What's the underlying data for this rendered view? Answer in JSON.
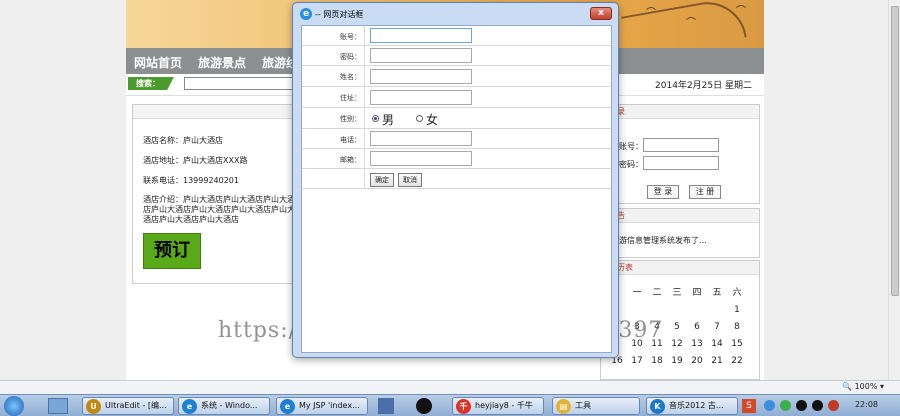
{
  "site": {
    "nav": [
      "网站首页",
      "旅游景点",
      "旅游线"
    ],
    "search_label": "搜索：",
    "date": "2014年2月25日 星期二"
  },
  "hotel": {
    "name_line": "酒店名称：庐山大酒店",
    "address_line": "酒店地址：庐山大酒店XXX路",
    "phone_line": "联系电话：13999240201",
    "intro_line": "酒店介绍：庐山大酒店庐山大酒店庐山大酒店庐山大酒店庐山大酒店庐山大酒店庐山大酒店庐山大酒店庐山大酒店",
    "book_label": "预订"
  },
  "sidebar": {
    "login_head": "录",
    "account_label": "账号：",
    "password_label": "密码：",
    "login_button": "登 录",
    "register_button": "注 册",
    "news_head": "告",
    "news_item": "游信息管理系统发布了…",
    "calendar_head": "历表",
    "calendar_weekdays": [
      "一",
      "二",
      "三",
      "四",
      "五",
      "六"
    ],
    "calendar_rows": [
      [
        "",
        "",
        "",
        "",
        "",
        "1"
      ],
      [
        "3",
        "4",
        "5",
        "6",
        "7",
        "8"
      ],
      [
        "10",
        "11",
        "12",
        "13",
        "14",
        "15"
      ],
      [
        "17",
        "18",
        "19",
        "20",
        "21",
        "22"
      ]
    ],
    "calendar_left_col": [
      "",
      "",
      "",
      "16"
    ]
  },
  "watermark": "https://www.huzhan.com/ishop39397",
  "dialog": {
    "title": "-- 网页对话框",
    "close": "x",
    "fields": [
      {
        "label": "账号："
      },
      {
        "label": "密码："
      },
      {
        "label": "姓名："
      },
      {
        "label": "住址："
      }
    ],
    "gender_label": "性别：",
    "gender_male": "男",
    "gender_female": "女",
    "fields2": [
      {
        "label": "电话："
      },
      {
        "label": "邮箱："
      }
    ],
    "ok_button": "确定",
    "cancel_button": "取消"
  },
  "statusbar": {
    "zoom": "100%"
  },
  "taskbar": {
    "tasks": [
      "UltraEdit - [编...",
      "系统 - Windo...",
      "My JSP 'index...",
      "heyjiay8 - 千牛",
      "工具",
      "音乐2012 古..."
    ],
    "clock": "22:08"
  },
  "colors": {
    "accent_green": "#5aa918",
    "nav_gray": "#8b8f90",
    "dialog_frame": "#c9dcf3"
  }
}
